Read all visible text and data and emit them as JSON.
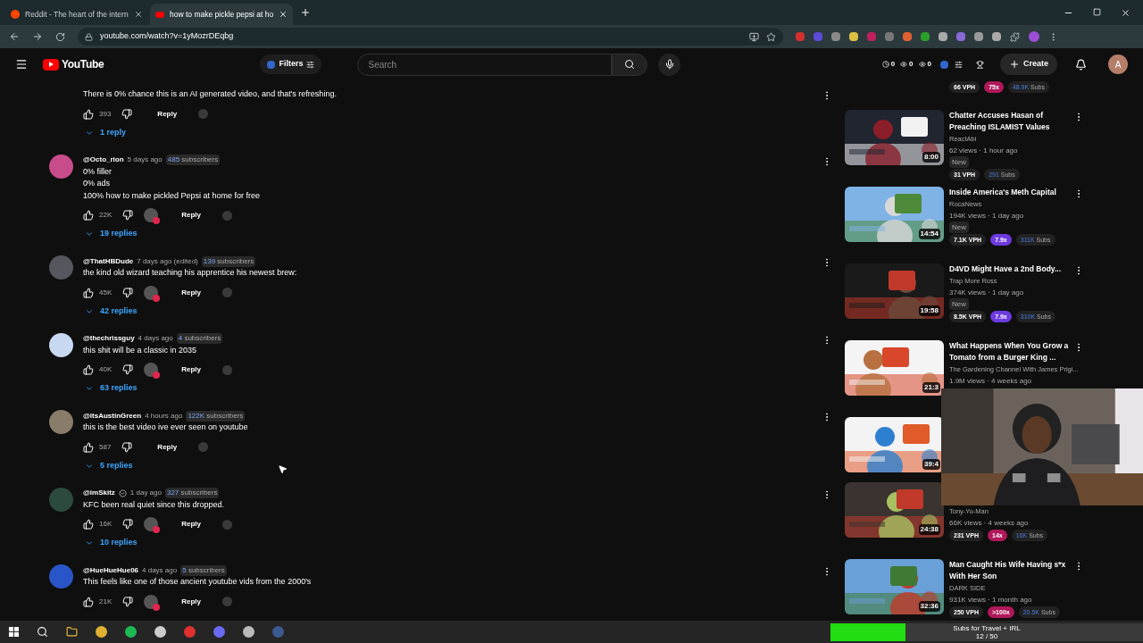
{
  "browser": {
    "tabs": [
      {
        "title": "Reddit - The heart of the intern",
        "selected": false,
        "kind": "reddit"
      },
      {
        "title": "how to make pickle pepsi at ho",
        "selected": true,
        "kind": "youtube"
      }
    ],
    "url": "youtube.com/watch?v=1yMozrDEqbg"
  },
  "header": {
    "logo_text": "YouTube",
    "filters": "Filters",
    "search_placeholder": "Search",
    "counters": [
      "0",
      "0",
      "0"
    ],
    "create": "Create",
    "avatar": "A"
  },
  "comments": [
    {
      "lines": [
        "There is 0% chance this is an AI generated video, and that's refreshing."
      ],
      "likes": "393",
      "hearted": false,
      "reply_label": "Reply",
      "replies": "1 reply"
    },
    {
      "author": "@Octo_rion",
      "verified": false,
      "time": "5 days ago",
      "subs_count": "485",
      "subs_word": "subscribers",
      "lines": [
        "0% filler",
        "0% ads",
        "100% how to make pickled Pepsi at home for free"
      ],
      "likes": "22K",
      "hearted": true,
      "reply_label": "Reply",
      "replies": "19 replies"
    },
    {
      "author": "@ThatHBDude",
      "verified": false,
      "time": "7 days ago (edited)",
      "subs_count": "139",
      "subs_word": "subscribers",
      "lines": [
        "the kind old wizard teaching his apprentice his newest brew:"
      ],
      "likes": "45K",
      "hearted": true,
      "reply_label": "Reply",
      "replies": "42 replies"
    },
    {
      "author": "@thechrissguy",
      "verified": false,
      "time": "4 days ago",
      "subs_count": "4",
      "subs_word": "subscribers",
      "lines": [
        "this shit will be a classic in 2035"
      ],
      "likes": "40K",
      "hearted": true,
      "reply_label": "Reply",
      "replies": "63 replies"
    },
    {
      "author": "@itsAustinGreen",
      "verified": false,
      "time": "4 hours ago",
      "subs_count": "122K",
      "subs_word": "subscribers",
      "lines": [
        "this is the best video ive ever seen on youtube"
      ],
      "likes": "587",
      "hearted": false,
      "reply_label": "Reply",
      "replies": "5 replies"
    },
    {
      "author": "@imSkitz",
      "verified": true,
      "time": "1 day ago",
      "subs_count": "327",
      "subs_word": "subscribers",
      "lines": [
        "KFC been real quiet since this dropped."
      ],
      "likes": "16K",
      "hearted": true,
      "reply_label": "Reply",
      "replies": "10 replies"
    },
    {
      "author": "@HueHueHue06",
      "verified": false,
      "time": "4 days ago",
      "subs_count": "5",
      "subs_word": "subscribers",
      "lines": [
        "This feels like one of those ancient youtube vids from the 2000's"
      ],
      "likes": "21K",
      "hearted": true,
      "reply_label": "Reply"
    }
  ],
  "videos": [
    {
      "vph": "66 VPH",
      "ratio": "75x",
      "color": "#b0185a",
      "subs_count": "48.9K",
      "subs_word": "Subs"
    },
    {
      "title": "Chatter Accuses Hasan of Preaching ISLAMIST Values",
      "channel": "ReactAbi",
      "meta": "62 views · 1 hour ago",
      "duration": "8:00",
      "is_new": true,
      "new_label": "New",
      "vph": "31 VPH",
      "subs_count": "291",
      "subs_word": "Subs"
    },
    {
      "title": "Inside America's Meth Capital",
      "channel": "RocaNews",
      "meta": "194K views · 1 day ago",
      "duration": "14:54",
      "is_new": true,
      "new_label": "New",
      "vph": "7.1K VPH",
      "ratio": "7.9x",
      "color": "#6d3ae0",
      "subs_count": "311K",
      "subs_word": "Subs"
    },
    {
      "title": "D4VD Might Have a 2nd Body...",
      "channel": "Trap More Ross",
      "meta": "374K views · 1 day ago",
      "duration": "19:58",
      "is_new": true,
      "new_label": "New",
      "vph": "8.5K VPH",
      "ratio": "7.9x",
      "color": "#6d3ae0",
      "subs_count": "310K",
      "subs_word": "Subs"
    },
    {
      "title": "What Happens When You Grow a Tomato from a Burger King ...",
      "channel": "The Gardening Channel With James Prigi...",
      "meta": "1.9M views · 4 weeks ago",
      "duration": "21:3"
    },
    {
      "duration": "39:4"
    },
    {
      "channel": "Tony-Yo-Man",
      "meta": "66K views · 4 weeks ago",
      "duration": "24:38",
      "vph": "231 VPH",
      "ratio": "14x",
      "color": "#b0185a",
      "subs_count": "16K",
      "subs_word": "Subs"
    },
    {
      "title": "Man Caught His Wife Having s*x With Her Son",
      "channel": "DARK SIDE",
      "meta": "931K views · 1 month ago",
      "duration": "32:36",
      "vph": "250 VPH",
      "ratio": ">100x",
      "color": "#b0185a",
      "subs_count": "20.5K",
      "subs_word": "Subs"
    }
  ],
  "goal": {
    "title": "Subs for Travel + IRL",
    "progress": "12 / 50",
    "level": 0.24
  }
}
